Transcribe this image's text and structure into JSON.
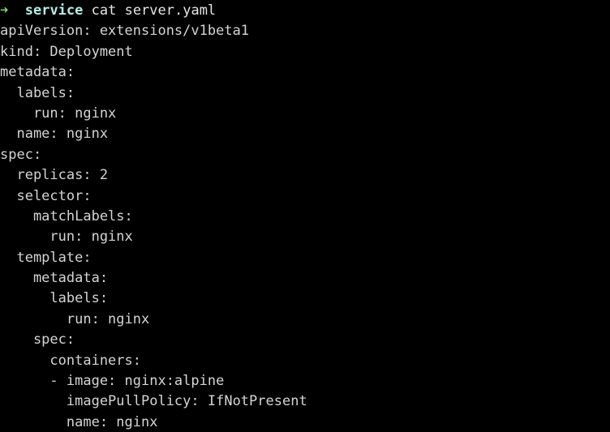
{
  "terminal": {
    "background_color": "#000000",
    "foreground_color": "#d4d4d4",
    "prompt": {
      "arrow_icon": "➜",
      "arrow_color": "#7fd962",
      "context": "service",
      "context_color": "#b2eee6",
      "command": "cat server.yaml",
      "command_color": "#e6e6e6",
      "full_line": "➜  service cat server.yaml"
    },
    "output_lines": [
      "apiVersion: extensions/v1beta1",
      "kind: Deployment",
      "metadata:",
      "  labels:",
      "    run: nginx",
      "  name: nginx",
      "spec:",
      "  replicas: 2",
      "  selector:",
      "    matchLabels:",
      "      run: nginx",
      "  template:",
      "    metadata:",
      "      labels:",
      "        run: nginx",
      "    spec:",
      "      containers:",
      "      - image: nginx:alpine",
      "        imagePullPolicy: IfNotPresent",
      "        name: nginx"
    ]
  }
}
